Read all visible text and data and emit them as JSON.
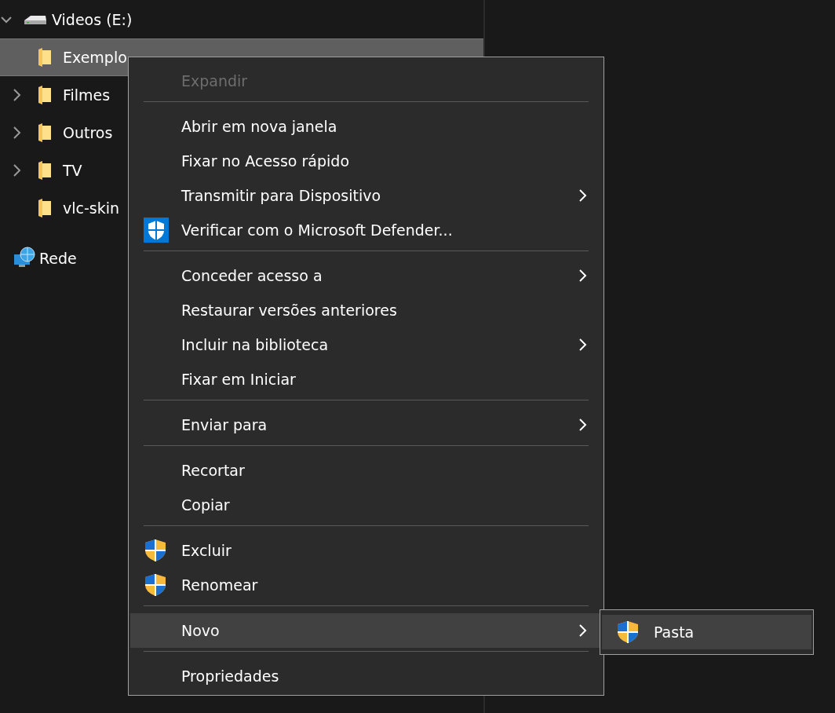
{
  "tree": [
    {
      "label": "Videos (E:)",
      "kind": "drive",
      "expandable": true,
      "expanded": true,
      "selected": false
    },
    {
      "label": "Exemplo",
      "kind": "folder",
      "expandable": false,
      "expanded": false,
      "selected": true
    },
    {
      "label": "Filmes",
      "kind": "folder",
      "expandable": true,
      "expanded": false,
      "selected": false
    },
    {
      "label": "Outros",
      "kind": "folder",
      "expandable": true,
      "expanded": false,
      "selected": false
    },
    {
      "label": "TV",
      "kind": "folder",
      "expandable": true,
      "expanded": false,
      "selected": false
    },
    {
      "label": "vlc-skin",
      "kind": "folder",
      "expandable": false,
      "expanded": false,
      "selected": false
    },
    {
      "label": "Rede",
      "kind": "network",
      "expandable": false,
      "expanded": false,
      "selected": false
    }
  ],
  "context_menu": [
    {
      "kind": "item",
      "label": "Expandir",
      "disabled": true,
      "submenu": false,
      "selected": false
    },
    {
      "kind": "separator"
    },
    {
      "kind": "item",
      "label": "Abrir em nova janela",
      "disabled": false,
      "submenu": false,
      "selected": false
    },
    {
      "kind": "item",
      "label": "Fixar no Acesso rápido",
      "disabled": false,
      "submenu": false,
      "selected": false
    },
    {
      "kind": "item",
      "label": "Transmitir para Dispositivo",
      "disabled": false,
      "submenu": true,
      "selected": false
    },
    {
      "kind": "defender-item",
      "label": "Verificar com o Microsoft Defender...",
      "disabled": false,
      "submenu": false,
      "selected": false
    },
    {
      "kind": "separator"
    },
    {
      "kind": "item",
      "label": "Conceder acesso a",
      "disabled": false,
      "submenu": true,
      "selected": false
    },
    {
      "kind": "item",
      "label": "Restaurar versões anteriores",
      "disabled": false,
      "submenu": false,
      "selected": false
    },
    {
      "kind": "item",
      "label": "Incluir na biblioteca",
      "disabled": false,
      "submenu": true,
      "selected": false
    },
    {
      "kind": "item",
      "label": "Fixar em Iniciar",
      "disabled": false,
      "submenu": false,
      "selected": false
    },
    {
      "kind": "separator"
    },
    {
      "kind": "item",
      "label": "Enviar para",
      "disabled": false,
      "submenu": true,
      "selected": false
    },
    {
      "kind": "separator"
    },
    {
      "kind": "item",
      "label": "Recortar",
      "disabled": false,
      "submenu": false,
      "selected": false
    },
    {
      "kind": "item",
      "label": "Copiar",
      "disabled": false,
      "submenu": false,
      "selected": false
    },
    {
      "kind": "separator"
    },
    {
      "kind": "admin-item",
      "label": "Excluir",
      "disabled": false,
      "submenu": false,
      "selected": false
    },
    {
      "kind": "admin-item",
      "label": "Renomear",
      "disabled": false,
      "submenu": false,
      "selected": false
    },
    {
      "kind": "separator"
    },
    {
      "kind": "item",
      "label": "Novo",
      "disabled": false,
      "submenu": true,
      "selected": true
    },
    {
      "kind": "separator"
    },
    {
      "kind": "item",
      "label": "Propriedades",
      "disabled": false,
      "submenu": false,
      "selected": false
    }
  ],
  "submenu": [
    {
      "kind": "admin-item",
      "label": "Pasta",
      "selected": true
    }
  ]
}
